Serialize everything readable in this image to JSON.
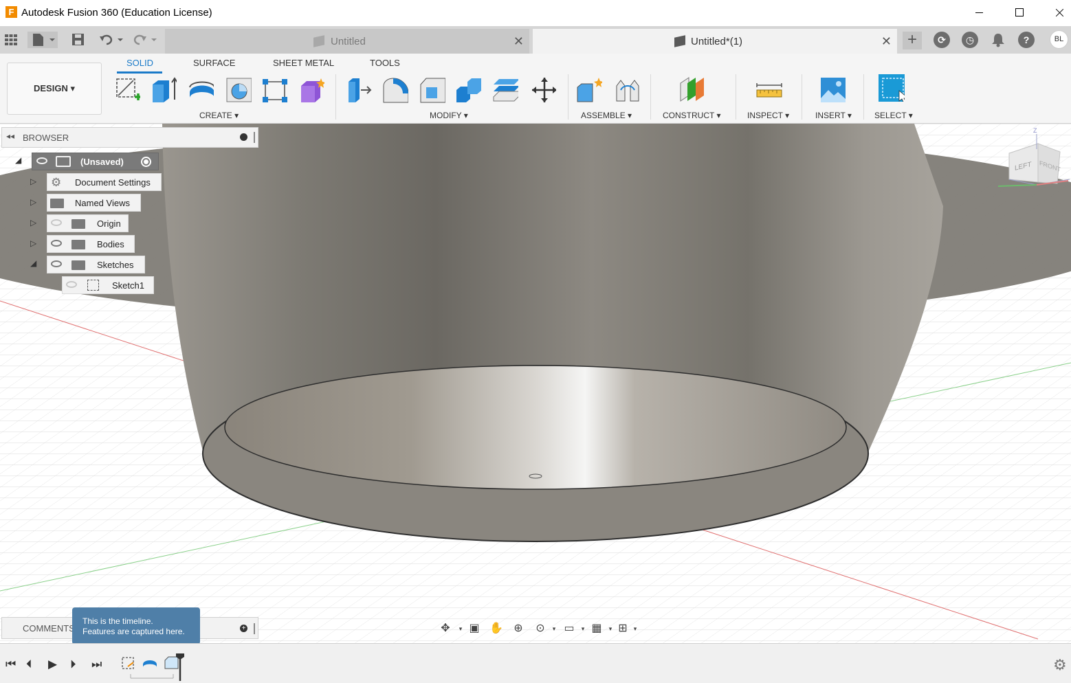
{
  "window": {
    "title": "Autodesk Fusion 360 (Education License)",
    "logo_letter": "F"
  },
  "tabs": {
    "items": [
      {
        "label": "Untitled",
        "active": false
      },
      {
        "label": "Untitled*(1)",
        "active": true
      }
    ],
    "close_glyph": "✕",
    "add_glyph": "+",
    "avatar": "BL"
  },
  "ribbon": {
    "workspace": "DESIGN",
    "tabs": [
      "SOLID",
      "SURFACE",
      "SHEET METAL",
      "TOOLS"
    ],
    "groups": [
      "CREATE",
      "MODIFY",
      "ASSEMBLE",
      "CONSTRUCT",
      "INSPECT",
      "INSERT",
      "SELECT"
    ],
    "accent": "#1a7ac8",
    "select_color": "#1a9ad6"
  },
  "browser": {
    "title": "BROWSER",
    "root": "(Unsaved)",
    "nodes": [
      {
        "label": "Document Settings",
        "icon": "gear-icon"
      },
      {
        "label": "Named Views",
        "icon": "folder-icon"
      },
      {
        "label": "Origin",
        "icon": "folder-icon",
        "visible": false
      },
      {
        "label": "Bodies",
        "icon": "folder-icon",
        "visible": true
      },
      {
        "label": "Sketches",
        "icon": "folder-icon",
        "visible": true,
        "expanded": true
      },
      {
        "label": "Sketch1",
        "icon": "sketch-icon",
        "visible": false
      }
    ]
  },
  "viewcube": {
    "left": "LEFT",
    "front": "FRONT",
    "axis_z": "Z"
  },
  "comments": {
    "label": "COMMENTS"
  },
  "tooltip": {
    "line1": "This is the timeline.",
    "line2": "Features are captured here."
  }
}
